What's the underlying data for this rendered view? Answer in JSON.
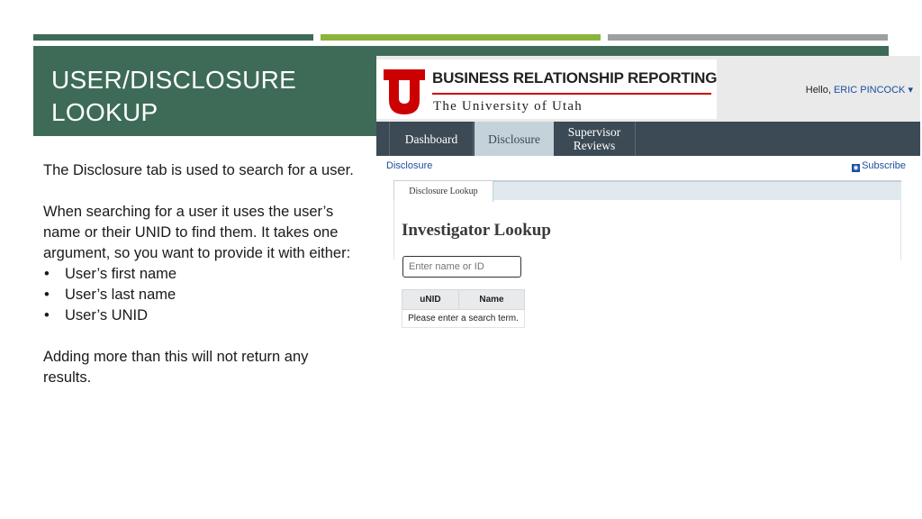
{
  "slide": {
    "title": "USER/DISCLOSURE LOOKUP",
    "intro": "The Disclosure tab is used to search for a user.",
    "description": "When searching for a user it uses the user’s name or their UNID to find them. It takes one argument, so you want to provide it with either:",
    "bullets": [
      "User’s first name",
      "User’s last name",
      "User’s UNID"
    ],
    "closing": "Adding more than this will not return any results."
  },
  "app": {
    "brand_title": "BUSINESS RELATIONSHIP REPORTING",
    "brand_subtitle": "The University of Utah",
    "greeting": "Hello,",
    "user_name": "ERIC PINCOCK",
    "nav": {
      "dashboard": "Dashboard",
      "disclosure": "Disclosure",
      "supervisor_reviews": "Supervisor Reviews"
    },
    "breadcrumb": "Disclosure",
    "subscribe": "Subscribe",
    "tab_label": "Disclosure Lookup",
    "page_title": "Investigator Lookup",
    "search": {
      "placeholder": "Enter name or ID",
      "value": ""
    },
    "table": {
      "headers": [
        "uNID",
        "Name"
      ],
      "empty_message": "Please enter a search term."
    }
  },
  "colors": {
    "slide_green": "#3d6b58",
    "accent_lime": "#8bb43c",
    "accent_gray": "#9d9fa1",
    "nav_dark": "#3b4a55",
    "utah_red": "#cc0000",
    "link_blue": "#1a4f9c"
  },
  "icons": {
    "logo": "block-u-logo",
    "subscribe": "rss-icon",
    "user_menu": "caret-down-icon"
  }
}
